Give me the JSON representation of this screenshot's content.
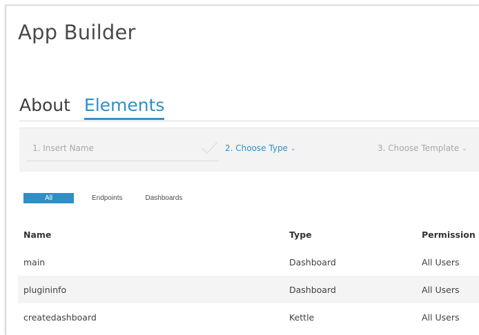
{
  "app": {
    "title": "App Builder"
  },
  "tabs": [
    {
      "label": "About",
      "active": false
    },
    {
      "label": "Elements",
      "active": true
    }
  ],
  "wizard": {
    "step1": {
      "placeholder": "1. Insert Name",
      "status_icon": "check-icon"
    },
    "step2": {
      "label": "2. Choose Type",
      "icon": "chevron-down-icon"
    },
    "step3": {
      "label": "3. Choose Template",
      "icon": "chevron-down-icon"
    }
  },
  "filters": [
    {
      "label": "All",
      "active": true
    },
    {
      "label": "Endpoints",
      "active": false
    },
    {
      "label": "Dashboards",
      "active": false
    }
  ],
  "table": {
    "columns": [
      "Name",
      "Type",
      "Permission"
    ],
    "rows": [
      {
        "name": "main",
        "type": "Dashboard",
        "permission": "All Users"
      },
      {
        "name": "plugininfo",
        "type": "Dashboard",
        "permission": "All Users"
      },
      {
        "name": "createdashboard",
        "type": "Kettle",
        "permission": "All Users"
      }
    ]
  },
  "colors": {
    "accent": "#2f8fc6",
    "text": "#3f3f3f",
    "muted": "#a8a8a8"
  }
}
